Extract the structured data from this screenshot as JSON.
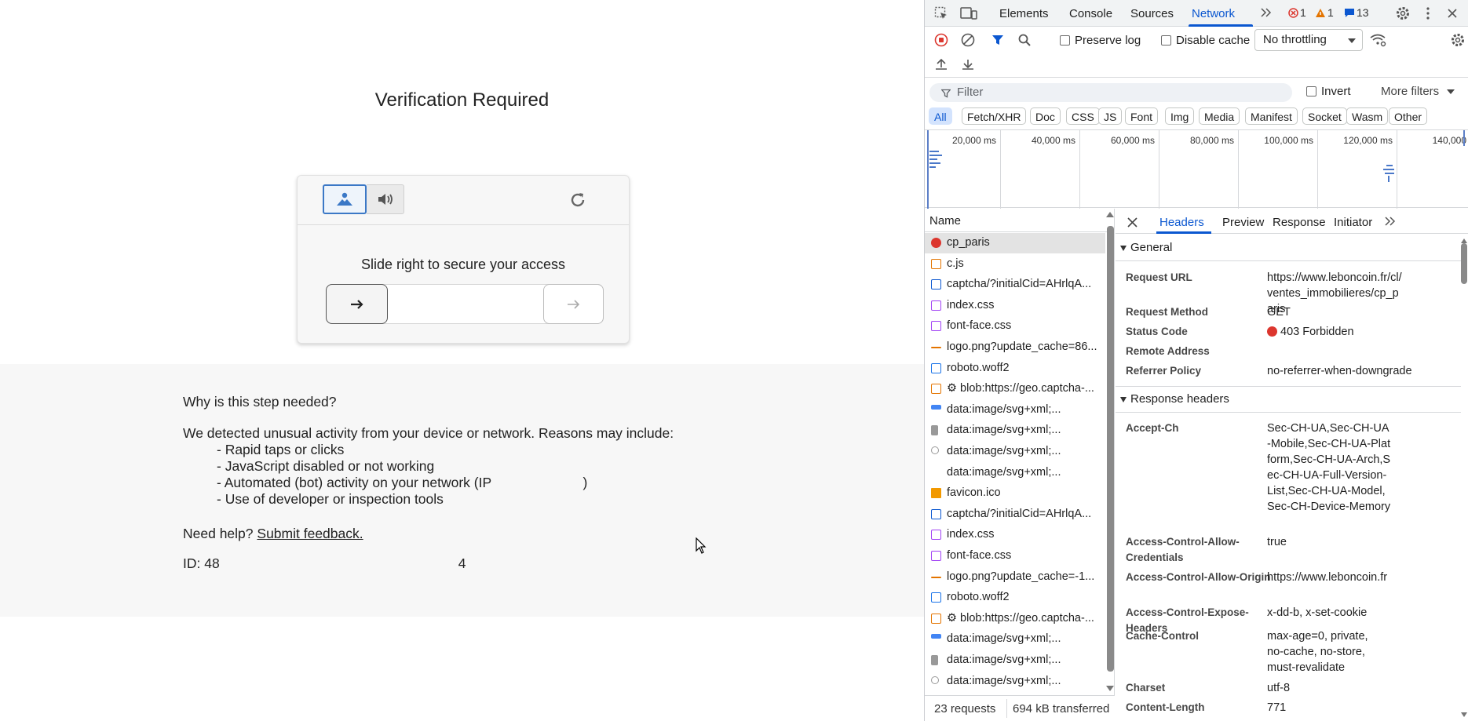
{
  "page": {
    "title": "Verification Required",
    "captcha": {
      "instruction": "Slide right to secure your access",
      "image_mode_icon": "image-icon",
      "audio_mode_icon": "speaker-icon",
      "refresh_icon": "refresh-icon"
    },
    "info": {
      "question": "Why is this step needed?",
      "intro": "We detected unusual activity from your device or network. Reasons may include:",
      "bullets": [
        "- Rapid taps or clicks",
        "- JavaScript disabled or not working",
        "- Automated (bot) activity on your network (IP                        )",
        "- Use of developer or inspection tools"
      ],
      "help_prefix": "Need help?",
      "help_link": "Submit feedback.",
      "id_prefix": "ID: 48",
      "id_suffix": "4"
    }
  },
  "devtools": {
    "tabs": [
      "Elements",
      "Console",
      "Sources",
      "Network"
    ],
    "active_tab": "Network",
    "counts": {
      "errors": "1",
      "warnings": "1",
      "messages": "13"
    },
    "colors": {
      "accent": "#0b57d0",
      "error": "#dc362e",
      "warning": "#e37400"
    },
    "toolbar": {
      "preserve_log": "Preserve log",
      "disable_cache": "Disable cache",
      "throttling": "No throttling"
    },
    "filter": {
      "placeholder": "Filter",
      "invert": "Invert",
      "more_filters": "More filters"
    },
    "type_filters": [
      "All",
      "Fetch/XHR",
      "Doc",
      "CSS",
      "JS",
      "Font",
      "Img",
      "Media",
      "Manifest",
      "Socket",
      "Wasm",
      "Other"
    ],
    "timeline_labels": [
      "20,000 ms",
      "40,000 ms",
      "60,000 ms",
      "80,000 ms",
      "100,000 ms",
      "120,000 ms",
      "140,000"
    ],
    "list_header": "Name",
    "requests": [
      {
        "name": "cp_paris",
        "type": "error"
      },
      {
        "name": "c.js",
        "type": "script"
      },
      {
        "name": "captcha/?initialCid=AHrlqA...",
        "type": "doc"
      },
      {
        "name": "index.css",
        "type": "css"
      },
      {
        "name": "font-face.css",
        "type": "css"
      },
      {
        "name": "logo.png?update_cache=86...",
        "type": "img"
      },
      {
        "name": "roboto.woff2",
        "type": "font"
      },
      {
        "name": "⚙ blob:https://geo.captcha-...",
        "type": "script"
      },
      {
        "name": "data:image/svg+xml;...",
        "type": "img-blue"
      },
      {
        "name": "data:image/svg+xml;...",
        "type": "audio"
      },
      {
        "name": "data:image/svg+xml;...",
        "type": "refresh"
      },
      {
        "name": "data:image/svg+xml;...",
        "type": "other"
      },
      {
        "name": "favicon.ico",
        "type": "favicon"
      },
      {
        "name": "captcha/?initialCid=AHrlqA...",
        "type": "doc"
      },
      {
        "name": "index.css",
        "type": "css"
      },
      {
        "name": "font-face.css",
        "type": "css"
      },
      {
        "name": "logo.png?update_cache=-1...",
        "type": "img"
      },
      {
        "name": "roboto.woff2",
        "type": "font"
      },
      {
        "name": "⚙ blob:https://geo.captcha-...",
        "type": "script"
      },
      {
        "name": "data:image/svg+xml;...",
        "type": "img-blue"
      },
      {
        "name": "data:image/svg+xml;...",
        "type": "audio"
      },
      {
        "name": "data:image/svg+xml;...",
        "type": "refresh"
      }
    ],
    "status": {
      "requests": "23 requests",
      "transferred": "694 kB transferred"
    },
    "detail_tabs": [
      "Headers",
      "Preview",
      "Response",
      "Initiator"
    ],
    "general": {
      "title": "General",
      "rows": [
        {
          "key": "Request URL",
          "value": "https://www.leboncoin.fr/cl/ventes_immobilieres/cp_paris"
        },
        {
          "key": "Request Method",
          "value": "GET"
        },
        {
          "key": "Status Code",
          "value": "403 Forbidden"
        },
        {
          "key": "Remote Address",
          "value": ""
        },
        {
          "key": "Referrer Policy",
          "value": "no-referrer-when-downgrade"
        }
      ]
    },
    "response_headers": {
      "title": "Response headers",
      "rows": [
        {
          "key": "Accept-Ch",
          "value": "Sec-CH-UA,Sec-CH-UA-Mobile,Sec-CH-UA-Platform,Sec-CH-UA-Arch,Sec-CH-UA-Full-Version-List,Sec-CH-UA-Model,Sec-CH-Device-Memory"
        },
        {
          "key": "Access-Control-Allow-Credentials",
          "value": "true"
        },
        {
          "key": "Access-Control-Allow-Origin",
          "value": "https://www.leboncoin.fr"
        },
        {
          "key": "Access-Control-Expose-Headers",
          "value": "x-dd-b, x-set-cookie"
        },
        {
          "key": "Cache-Control",
          "value": "max-age=0, private, no-cache, no-store, must-revalidate"
        },
        {
          "key": "Charset",
          "value": "utf-8"
        },
        {
          "key": "Content-Length",
          "value": "771"
        }
      ]
    }
  }
}
